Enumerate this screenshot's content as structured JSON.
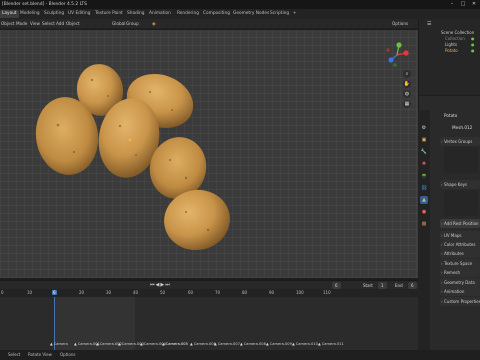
{
  "window": {
    "title": "[Blender set.blend] - Blender 4.5.2 LTS",
    "controls": [
      "–",
      "□",
      "✕"
    ]
  },
  "workspace_tabs": [
    "Layout",
    "Modeling",
    "Sculpting",
    "UV Editing",
    "Texture Paint",
    "Shading",
    "Animation",
    "Rendering",
    "Compositing",
    "Geometry Nodes",
    "Scripting",
    "+"
  ],
  "viewport_header": {
    "mode": "Object Mode",
    "menus": [
      "View",
      "Select",
      "Add",
      "Object"
    ],
    "transform": "Global",
    "snap_label": "Group",
    "options": "Options"
  },
  "outliner": {
    "items": [
      "Scene Collection",
      "Collection",
      "Lights",
      "Potato"
    ]
  },
  "properties": {
    "object_name": "Potato",
    "mesh_name": "Mesh.012",
    "panels": [
      "Vertex Groups",
      "Shape Keys",
      "UV Maps",
      "Color Attributes",
      "Attributes",
      "Texture Space",
      "Remesh",
      "Geometry Data",
      "Animation",
      "Custom Properties"
    ],
    "add_rest_position": "Add Rest Position"
  },
  "timeline": {
    "ticks": [
      "0",
      "10",
      "20",
      "30",
      "40",
      "50",
      "60",
      "70",
      "80",
      "90",
      "100",
      "110"
    ],
    "current_frame": "6",
    "start_label": "Start",
    "start_value": "1",
    "end_label": "End",
    "end_value": "6",
    "markers": [
      "Camera",
      "Camera.001",
      "Camera.002",
      "Camera.003",
      "Camera.004",
      "Camera.005",
      "Camera.006",
      "Camera.007",
      "Camera.008",
      "Camera.009",
      "Camera.010",
      "Camera.011"
    ]
  },
  "statusbar": {
    "items": [
      "Select",
      "Rotate View",
      "Options"
    ]
  },
  "colors": {
    "accent": "#4772b3",
    "potato_skin": "#c9944a",
    "x_axis": "#e03b3b",
    "y_axis": "#6fbf45",
    "z_axis": "#3b73e0"
  }
}
